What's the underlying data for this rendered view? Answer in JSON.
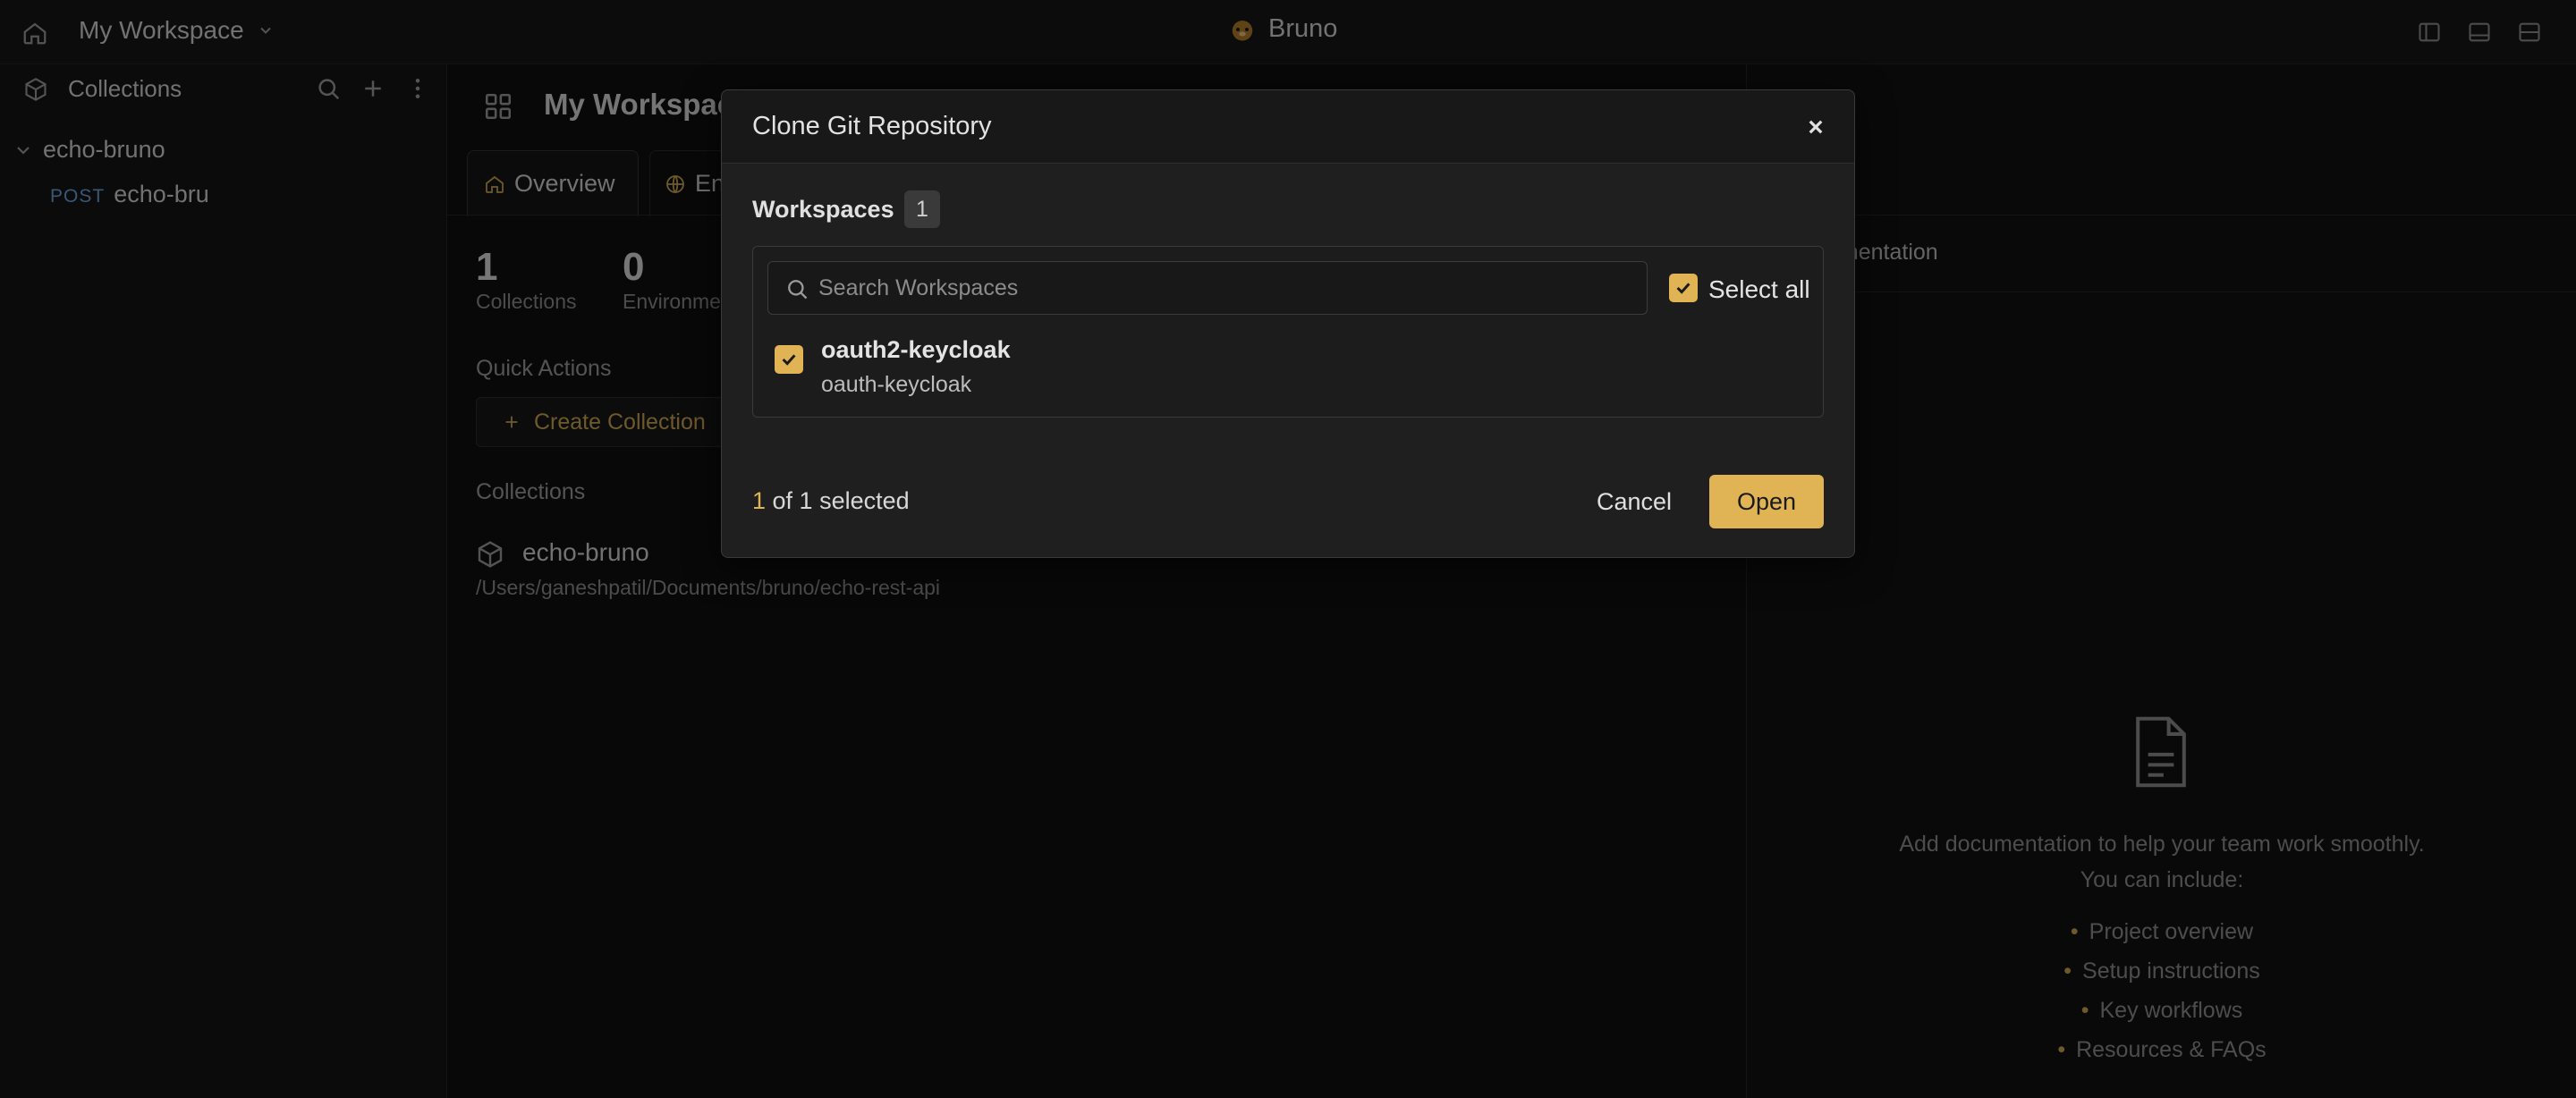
{
  "titlebar": {
    "workspace": "My Workspace",
    "app_name": "Bruno"
  },
  "sidebar": {
    "title": "Collections",
    "tree_root": "echo-bruno",
    "tree_request": {
      "method": "POST",
      "name": "echo-bru"
    }
  },
  "main": {
    "workspace_title": "My Workspac",
    "tabs": [
      {
        "label": "Overview"
      },
      {
        "label": "En"
      }
    ],
    "stats": [
      {
        "value": "1",
        "label": "Collections"
      },
      {
        "value": "0",
        "label": "Environme"
      }
    ],
    "quick_actions_title": "Quick Actions",
    "create_collection_label": "Create Collection",
    "collections_title": "Collections",
    "collection": {
      "name": "echo-bruno",
      "path": "/Users/ganeshpatil/Documents/bruno/echo-rest-api"
    }
  },
  "docs": {
    "tab_label": "umentation",
    "help_line1": "Add documentation to help your team work smoothly.",
    "help_line2": "You can include:",
    "items": [
      "Project overview",
      "Setup instructions",
      "Key workflows",
      "Resources & FAQs"
    ]
  },
  "modal": {
    "title": "Clone Git Repository",
    "workspaces_label": "Workspaces",
    "workspaces_count": "1",
    "search_placeholder": "Search Workspaces",
    "select_all_label": "Select all",
    "workspace_item": {
      "name": "oauth2-keycloak",
      "sub": "oauth-keycloak"
    },
    "summary_selected": "1",
    "summary_rest": " of 1 selected",
    "cancel_label": "Cancel",
    "open_label": "Open"
  },
  "colors": {
    "accent": "#e0b354",
    "background": "#121212",
    "method_post": "#6a9fd8"
  }
}
